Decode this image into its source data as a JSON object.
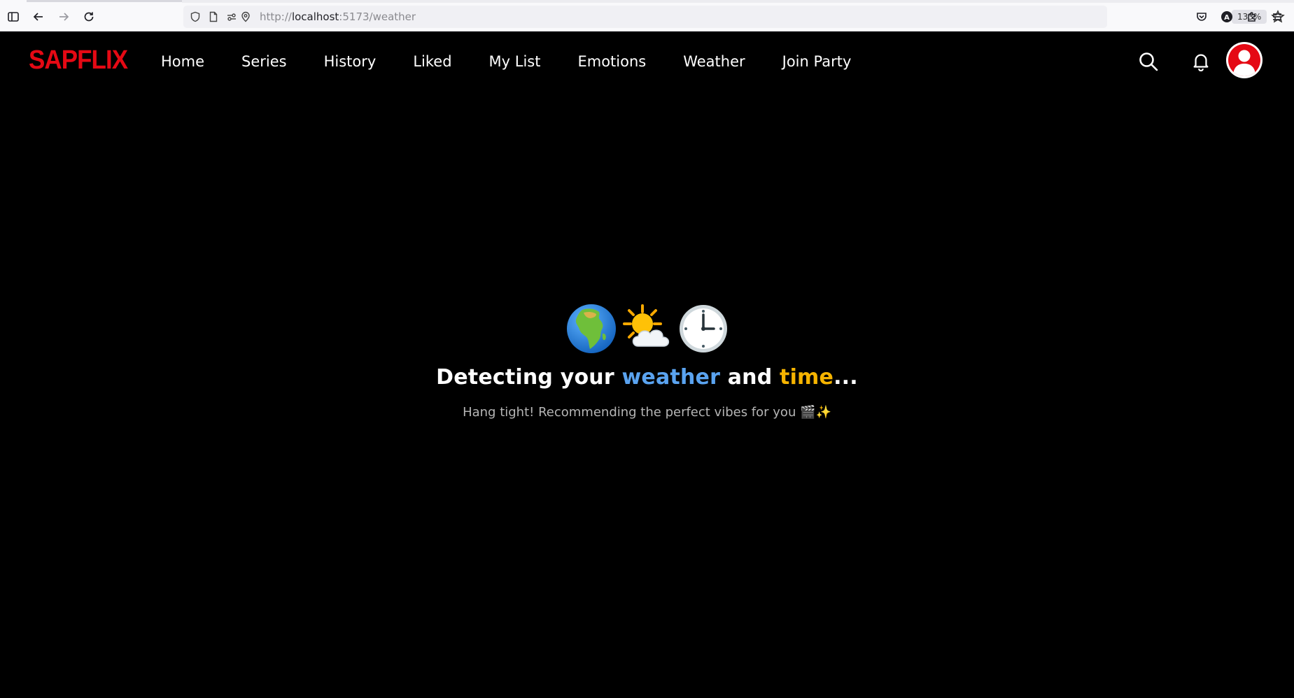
{
  "browser": {
    "url_scheme": "http://",
    "url_host": "localhost",
    "url_path": ":5173/weather",
    "zoom": "133%"
  },
  "app": {
    "logo": "SAPFLIX",
    "nav": [
      {
        "label": "Home"
      },
      {
        "label": "Series"
      },
      {
        "label": "History"
      },
      {
        "label": "Liked"
      },
      {
        "label": "My List"
      },
      {
        "label": "Emotions"
      },
      {
        "label": "Weather"
      },
      {
        "label": "Join Party"
      }
    ],
    "accent_color": "#e50914"
  },
  "loading": {
    "emojis": [
      "globe-africa-icon",
      "sun-behind-cloud-icon",
      "clock-three-icon"
    ],
    "headline_pre": "Detecting your ",
    "headline_weather": "weather",
    "headline_mid": " and ",
    "headline_time": "time",
    "headline_post": "...",
    "subtitle": "Hang tight! Recommending the perfect vibes for you 🎬✨",
    "colors": {
      "weather": "#5aa3f0",
      "time": "#f6b400"
    }
  }
}
